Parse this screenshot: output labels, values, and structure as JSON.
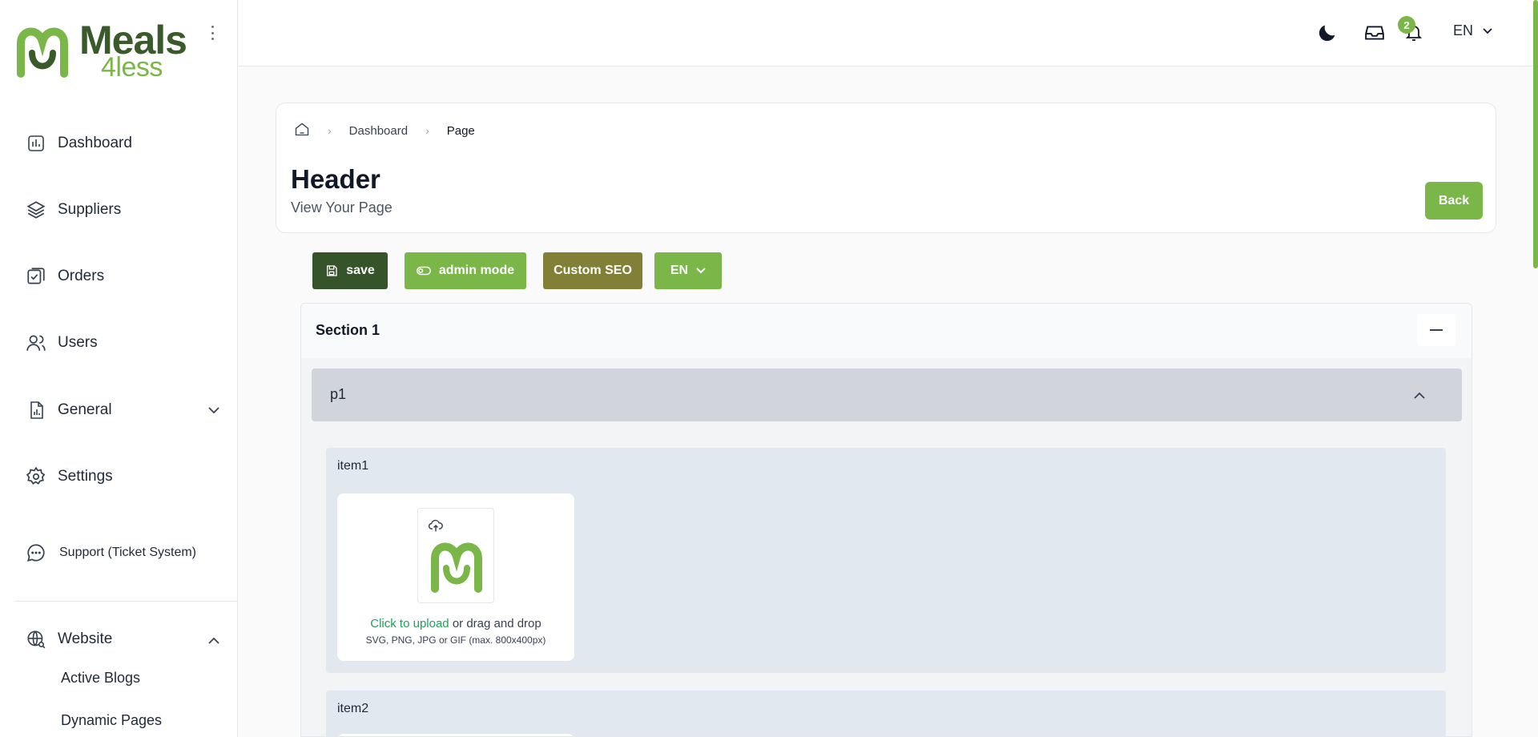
{
  "brand": {
    "word1": "Meals",
    "word2": "4less"
  },
  "sidebar": {
    "items": [
      {
        "label": "Dashboard"
      },
      {
        "label": "Suppliers"
      },
      {
        "label": "Orders"
      },
      {
        "label": "Users"
      },
      {
        "label": "General"
      },
      {
        "label": "Settings"
      },
      {
        "label": "Support (Ticket System)"
      },
      {
        "label": "Website"
      }
    ],
    "website_sub": [
      "Active Blogs",
      "Dynamic Pages"
    ]
  },
  "topbar": {
    "notification_count": "2",
    "language": "EN"
  },
  "breadcrumb": {
    "items": [
      "Dashboard",
      "Page"
    ]
  },
  "page": {
    "title": "Header",
    "subtitle": "View Your Page",
    "back_label": "Back"
  },
  "toolbar": {
    "save_label": "save",
    "admin_label": "admin mode",
    "seo_label": "Custom SEO",
    "lang_label": "EN"
  },
  "section": {
    "title": "Section 1",
    "group": "p1",
    "items": [
      {
        "label": "item1",
        "upload_link": "Click to upload",
        "upload_rest": " or drag and drop",
        "upload_hint": "SVG, PNG, JPG or GIF (max. 800x400px)"
      },
      {
        "label": "item2"
      }
    ]
  },
  "colors": {
    "brand_green": "#7ab648",
    "dark_green": "#35542a",
    "olive": "#818036",
    "link_green": "#22a05a"
  }
}
